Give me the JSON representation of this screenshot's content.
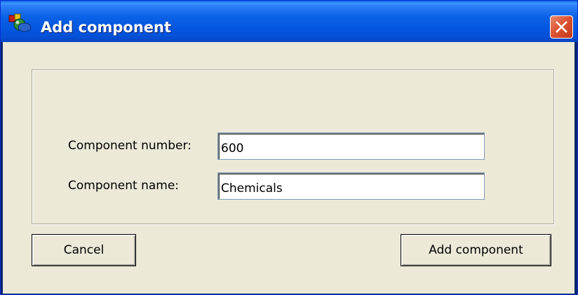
{
  "window": {
    "title": "Add component",
    "icon": "app-icon",
    "close_icon": "close-icon",
    "colors": {
      "titlebar": "#0b61e6",
      "client": "#ece9d8",
      "close_button": "#dd5433"
    }
  },
  "form": {
    "component_number_label": "Component number:",
    "component_number_value": "600",
    "component_name_label": "Component name:",
    "component_name_value": "Chemicals"
  },
  "buttons": {
    "cancel_label": "Cancel",
    "add_label": "Add component"
  }
}
